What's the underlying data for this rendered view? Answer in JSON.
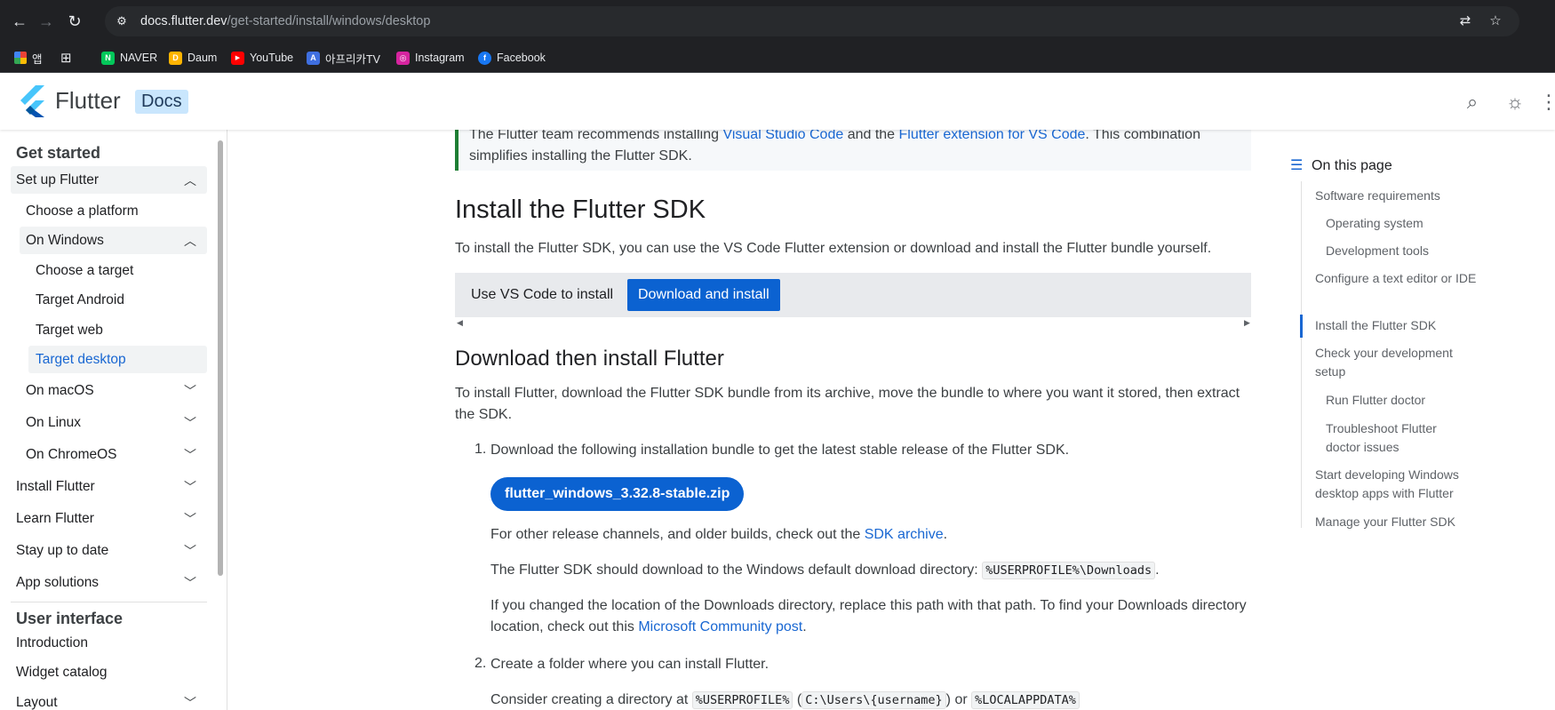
{
  "browser": {
    "url_host": "docs.flutter.dev",
    "url_path": "/get-started/install/windows/desktop",
    "bookmarks": [
      {
        "label": "앱",
        "color": "#e8eaed"
      },
      {
        "label": "",
        "color": "#e8eaed"
      },
      {
        "label": "NAVER",
        "color": "#03c75a",
        "glyph": "N"
      },
      {
        "label": "Daum",
        "color": "#ffb400",
        "glyph": "D"
      },
      {
        "label": "YouTube",
        "color": "#ff0000",
        "glyph": "▶"
      },
      {
        "label": "아프리카TV",
        "color": "#3f6fe0",
        "glyph": "A"
      },
      {
        "label": "Instagram",
        "color": "#d6249f",
        "glyph": "◎"
      },
      {
        "label": "Facebook",
        "color": "#1877f2",
        "glyph": "f"
      }
    ]
  },
  "header": {
    "logo_text": "Flutter",
    "badge": "Docs"
  },
  "sidebar": {
    "section1": "Get started",
    "items": [
      {
        "label": "Set up Flutter",
        "level": 0,
        "chevron": "up"
      },
      {
        "label": "Choose a platform",
        "level": 1,
        "chevron": ""
      },
      {
        "label": "On Windows",
        "level": 1,
        "chevron": "up"
      },
      {
        "label": "Choose a target",
        "level": 2,
        "chevron": ""
      },
      {
        "label": "Target Android",
        "level": 2,
        "chevron": ""
      },
      {
        "label": "Target web",
        "level": 2,
        "chevron": ""
      },
      {
        "label": "Target desktop",
        "level": 2,
        "chevron": ""
      },
      {
        "label": "On macOS",
        "level": 1,
        "chevron": "down"
      },
      {
        "label": "On Linux",
        "level": 1,
        "chevron": "down"
      },
      {
        "label": "On ChromeOS",
        "level": 1,
        "chevron": "down"
      },
      {
        "label": "Install Flutter",
        "level": 0,
        "chevron": "down"
      },
      {
        "label": "Learn Flutter",
        "level": 0,
        "chevron": "down"
      },
      {
        "label": "Stay up to date",
        "level": 0,
        "chevron": "down"
      },
      {
        "label": "App solutions",
        "level": 0,
        "chevron": "down"
      }
    ],
    "section2": "User interface",
    "items2": [
      {
        "label": "Introduction",
        "chevron": ""
      },
      {
        "label": "Widget catalog",
        "chevron": ""
      },
      {
        "label": "Layout",
        "chevron": "down"
      }
    ]
  },
  "main": {
    "callout_pre": "The Flutter team recommends installing ",
    "callout_link1": "Visual Studio Code",
    "callout_mid": " and the ",
    "callout_link2": "Flutter extension for VS Code",
    "callout_post": ". This combination simplifies installing the Flutter SDK.",
    "h2": "Install the Flutter SDK",
    "intro": "To install the Flutter SDK, you can use the VS Code Flutter extension or download and install the Flutter bundle yourself.",
    "tabs": [
      "Use VS Code to install",
      "Download and install"
    ],
    "h3": "Download then install Flutter",
    "p2": "To install Flutter, download the Flutter SDK bundle from its archive, move the bundle to where you want it stored, then extract the SDK.",
    "step1": "Download the following installation bundle to get the latest stable release of the Flutter SDK.",
    "download_label": "flutter_windows_3.32.8-stable.zip",
    "archive_pre": "For other release channels, and older builds, check out the ",
    "archive_link": "SDK archive",
    "archive_post": ".",
    "dir_pre": "The Flutter SDK should download to the Windows default download directory: ",
    "dir_code": "%USERPROFILE%\\Downloads",
    "dir_post": ".",
    "change_pre": "If you changed the location of the Downloads directory, replace this path with that path. To find your Downloads directory location, check out this ",
    "change_link": "Microsoft Community post",
    "change_post": ".",
    "step2": "Create a folder where you can install Flutter.",
    "consider_pre": "Consider creating a directory at ",
    "consider_code1": "%USERPROFILE%",
    "consider_code2": "C:\\Users\\{username}",
    "consider_code3": "%LOCALAPPDATA%",
    "consider_paren_open": " (",
    "consider_paren_close": ") or "
  },
  "toc": {
    "title": "On this page",
    "items": [
      {
        "label": "Software requirements",
        "indent": 0
      },
      {
        "label": "Operating system",
        "indent": 1
      },
      {
        "label": "Development tools",
        "indent": 1
      },
      {
        "label": "Configure a text editor or IDE",
        "indent": 0
      },
      {
        "label": "Install the Flutter SDK",
        "indent": 0
      },
      {
        "label": "Check your development setup",
        "indent": 0
      },
      {
        "label": "Run Flutter doctor",
        "indent": 1
      },
      {
        "label": "Troubleshoot Flutter doctor issues",
        "indent": 1
      },
      {
        "label": "Start developing Windows desktop apps with Flutter",
        "indent": 0
      },
      {
        "label": "Manage your Flutter SDK",
        "indent": 0
      }
    ]
  }
}
